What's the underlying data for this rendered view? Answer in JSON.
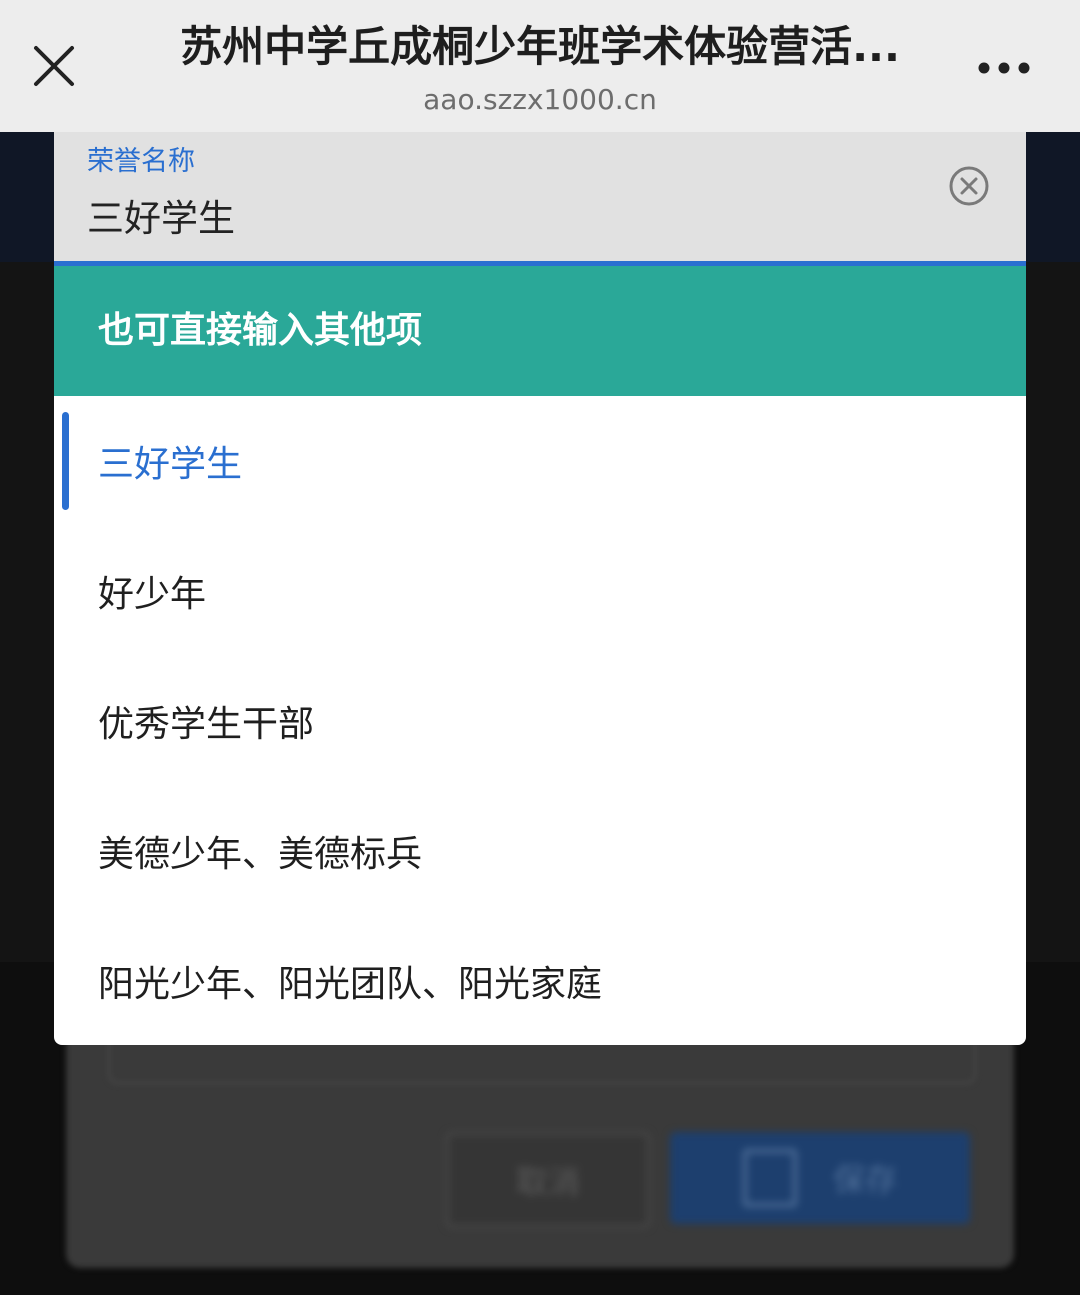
{
  "browser": {
    "title": "苏州中学丘成桐少年班学术体验营活...",
    "url": "aao.szzx1000.cn",
    "close_icon": "close-icon",
    "more_icon": "more-dots-icon"
  },
  "field": {
    "label": "荣誉名称",
    "value": "三好学生",
    "clear_icon": "clear-circle-icon"
  },
  "hint": "也可直接输入其他项",
  "options": [
    {
      "label": "三好学生",
      "selected": true
    },
    {
      "label": "好少年",
      "selected": false
    },
    {
      "label": "优秀学生干部",
      "selected": false
    },
    {
      "label": "美德少年、美德标兵",
      "selected": false
    },
    {
      "label": "阳光少年、阳光团队、阳光家庭",
      "selected": false
    }
  ],
  "background": {
    "cancel_label": "取消",
    "save_label": "保存",
    "save_icon": "save-icon"
  },
  "colors": {
    "accent": "#2a6fd0",
    "hint_bg": "#2aa898",
    "field_bg": "#e1e1e1",
    "topbar_bg": "#ededed"
  }
}
